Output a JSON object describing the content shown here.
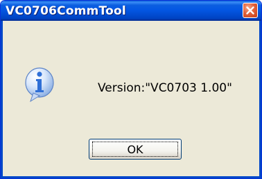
{
  "window": {
    "title": "VC0706CommTool",
    "close_icon": "close-icon"
  },
  "dialog": {
    "icon": "info-icon",
    "message": "Version:\"VC0703 1.00\""
  },
  "buttons": {
    "ok_label": "OK"
  },
  "colors": {
    "titlebar": "#0047c9",
    "dialog_bg": "#ece9d8",
    "close_button": "#d9532c",
    "info_icon": "#2f6fd6"
  }
}
